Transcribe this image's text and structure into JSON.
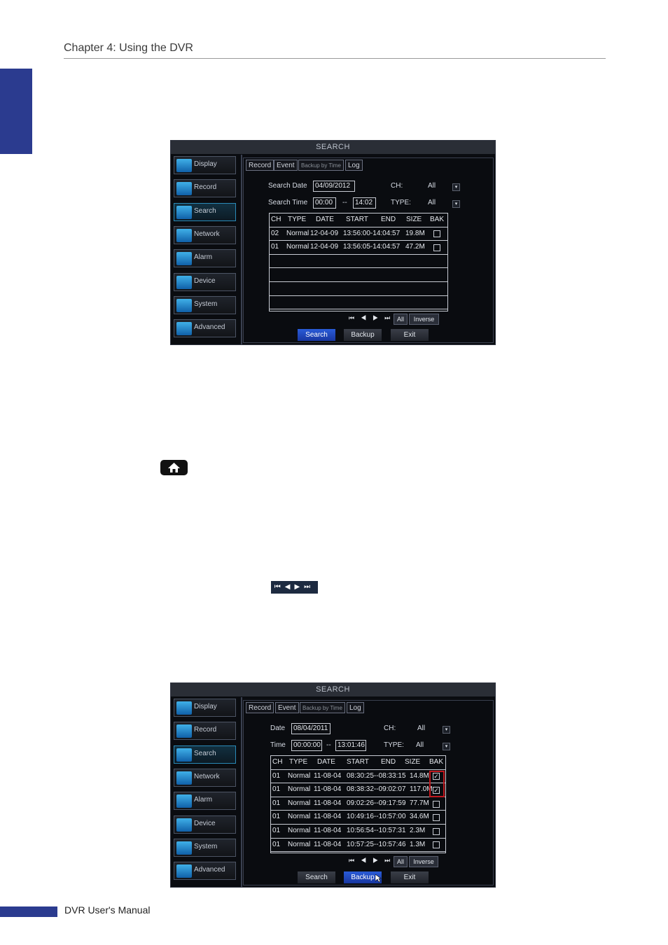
{
  "header": {
    "title": "Chapter 4: Using the DVR"
  },
  "footer": {
    "title": "DVR User's Manual"
  },
  "screen1": {
    "title": "SEARCH",
    "menu": [
      "Display",
      "Record",
      "Search",
      "Network",
      "Alarm",
      "Device",
      "System",
      "Advanced"
    ],
    "tabs": [
      "Record",
      "Event",
      "Backup by Time",
      "Log"
    ],
    "date_label": "Search Date",
    "date_value": "04/09/2012",
    "time_label": "Search Time",
    "time_start": "00:00",
    "time_sep": "--",
    "time_end": "14:02",
    "ch_label": "CH:",
    "ch_value": "All",
    "type_label": "TYPE:",
    "type_value": "All",
    "columns": [
      "CH",
      "TYPE",
      "DATE",
      "START",
      "END",
      "SIZE",
      "BAK"
    ],
    "rows": [
      {
        "ch": "02",
        "type": "Normal",
        "date": "12-04-09",
        "time": "13:56:00-14:04:57",
        "size": "19.8M",
        "checked": false
      },
      {
        "ch": "01",
        "type": "Normal",
        "date": "12-04-09",
        "time": "13:56:05-14:04:57",
        "size": "47.2M",
        "checked": false
      }
    ],
    "nav": "⏮◀▶⏭",
    "all_label": "All",
    "inverse_label": "Inverse",
    "buttons": [
      "Search",
      "Backup",
      "Exit"
    ]
  },
  "screen2": {
    "title": "SEARCH",
    "menu": [
      "Display",
      "Record",
      "Search",
      "Network",
      "Alarm",
      "Device",
      "System",
      "Advanced"
    ],
    "tabs": [
      "Record",
      "Event",
      "Backup by Time",
      "Log"
    ],
    "date_label": "Date",
    "date_value": "08/04/2011",
    "time_label": "Time",
    "time_start": "00:00:00",
    "time_sep": "--",
    "time_end": "13:01:46",
    "ch_label": "CH:",
    "ch_value": "All",
    "type_label": "TYPE:",
    "type_value": "All",
    "columns": [
      "CH",
      "TYPE",
      "DATE",
      "START",
      "END",
      "SIZE",
      "BAK"
    ],
    "rows": [
      {
        "ch": "01",
        "type": "Normal",
        "date": "11-08-04",
        "time": "08:30:25--08:33:15",
        "size": "14.8M",
        "checked": true
      },
      {
        "ch": "01",
        "type": "Normal",
        "date": "11-08-04",
        "time": "08:38:32--09:02:07",
        "size": "117.0M",
        "checked": true
      },
      {
        "ch": "01",
        "type": "Normal",
        "date": "11-08-04",
        "time": "09:02:26--09:17:59",
        "size": "77.7M",
        "checked": false
      },
      {
        "ch": "01",
        "type": "Normal",
        "date": "11-08-04",
        "time": "10:49:16--10:57:00",
        "size": "34.6M",
        "checked": false
      },
      {
        "ch": "01",
        "type": "Normal",
        "date": "11-08-04",
        "time": "10:56:54--10:57:31",
        "size": "2.3M",
        "checked": false
      },
      {
        "ch": "01",
        "type": "Normal",
        "date": "11-08-04",
        "time": "10:57:25--10:57:46",
        "size": "1.3M",
        "checked": false
      }
    ],
    "nav": "⏮◀▶⏭",
    "all_label": "All",
    "inverse_label": "Inverse",
    "buttons": [
      "Search",
      "Backup",
      "Exit"
    ]
  },
  "inline": {
    "nav_strip": "⏮◀▶⏭"
  }
}
